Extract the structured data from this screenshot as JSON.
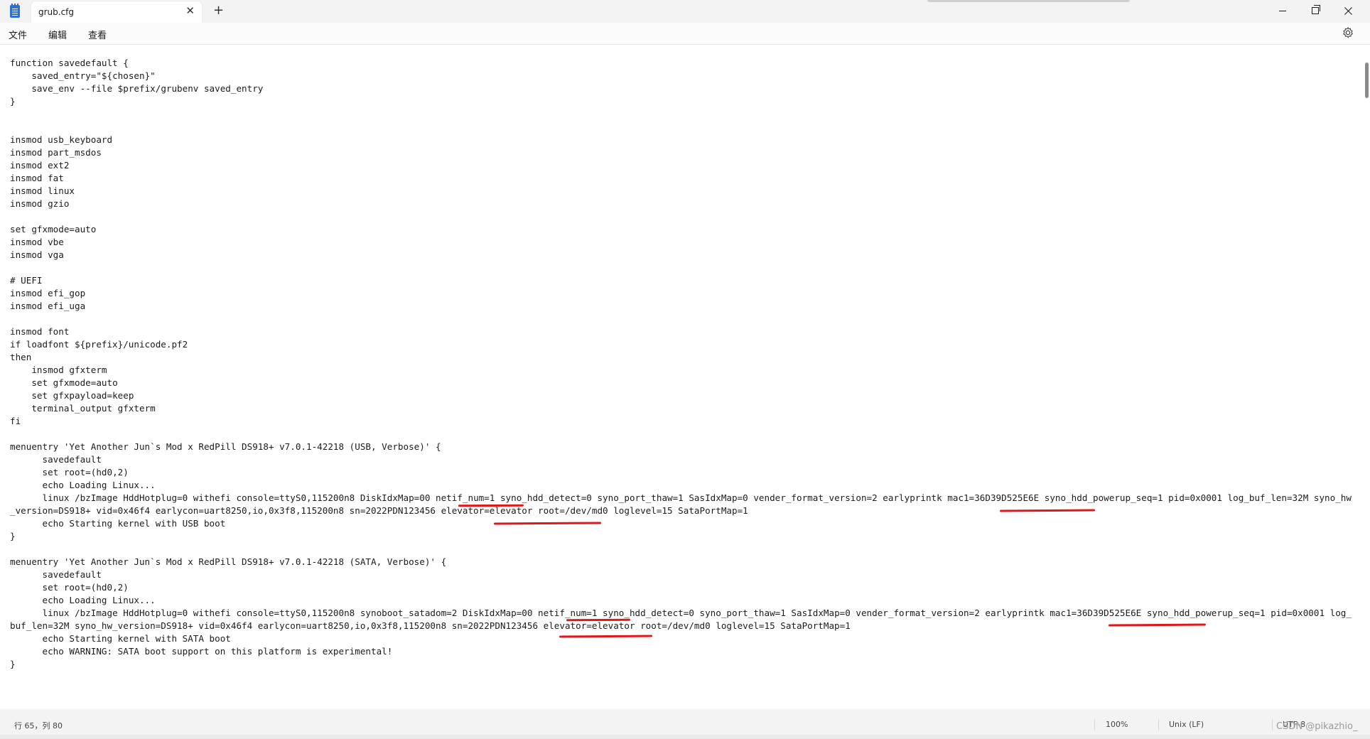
{
  "window": {
    "tab_title": "grub.cfg",
    "close_tab_glyph": "✕",
    "new_tab_glyph": "+",
    "icons": {
      "app": "notepad-icon",
      "minimize": "minimize-icon",
      "maximize": "restore-icon",
      "close": "close-icon",
      "settings": "gear-icon"
    }
  },
  "menu": {
    "file": "文件",
    "edit": "编辑",
    "view": "查看"
  },
  "editor": {
    "content": "function savedefault {\n    saved_entry=\"${chosen}\"\n    save_env --file $prefix/grubenv saved_entry\n}\n\n\ninsmod usb_keyboard\ninsmod part_msdos\ninsmod ext2\ninsmod fat\ninsmod linux\ninsmod gzio\n\nset gfxmode=auto\ninsmod vbe\ninsmod vga\n\n# UEFI\ninsmod efi_gop\ninsmod efi_uga\n\ninsmod font\nif loadfont ${prefix}/unicode.pf2\nthen\n    insmod gfxterm\n    set gfxmode=auto\n    set gfxpayload=keep\n    terminal_output gfxterm\nfi\n\nmenuentry 'Yet Another Jun`s Mod x RedPill DS918+ v7.0.1-42218 (USB, Verbose)' {\n      savedefault\n      set root=(hd0,2)\n      echo Loading Linux...\n      linux /bzImage HddHotplug=0 withefi console=ttyS0,115200n8 DiskIdxMap=00 netif_num=1 syno_hdd_detect=0 syno_port_thaw=1 SasIdxMap=0 vender_format_version=2 earlyprintk mac1=36D39D525E6E syno_hdd_powerup_seq=1 pid=0x0001 log_buf_len=32M syno_hw_version=DS918+ vid=0x46f4 earlycon=uart8250,io,0x3f8,115200n8 sn=2022PDN123456 elevator=elevator root=/dev/md0 loglevel=15 SataPortMap=1\n      echo Starting kernel with USB boot\n}\n\nmenuentry 'Yet Another Jun`s Mod x RedPill DS918+ v7.0.1-42218 (SATA, Verbose)' {\n      savedefault\n      set root=(hd0,2)\n      echo Loading Linux...\n      linux /bzImage HddHotplug=0 withefi console=ttyS0,115200n8 synoboot_satadom=2 DiskIdxMap=00 netif_num=1 syno_hdd_detect=0 syno_port_thaw=1 SasIdxMap=0 vender_format_version=2 earlyprintk mac1=36D39D525E6E syno_hdd_powerup_seq=1 pid=0x0001 log_buf_len=32M syno_hw_version=DS918+ vid=0x46f4 earlycon=uart8250,io,0x3f8,115200n8 sn=2022PDN123456 elevator=elevator root=/dev/md0 loglevel=15 SataPortMap=1\n      echo Starting kernel with SATA boot\n      echo WARNING: SATA boot support on this platform is experimental!\n}"
  },
  "status": {
    "position": "行 65，列 80",
    "zoom": "100%",
    "line_ending": "Unix (LF)",
    "encoding": "UTF-8"
  },
  "watermark": "CSDN @pikazhio_",
  "colors": {
    "annotation": "#e01818",
    "chrome_background": "#f3f3f3",
    "editor_background": "#ffffff"
  }
}
